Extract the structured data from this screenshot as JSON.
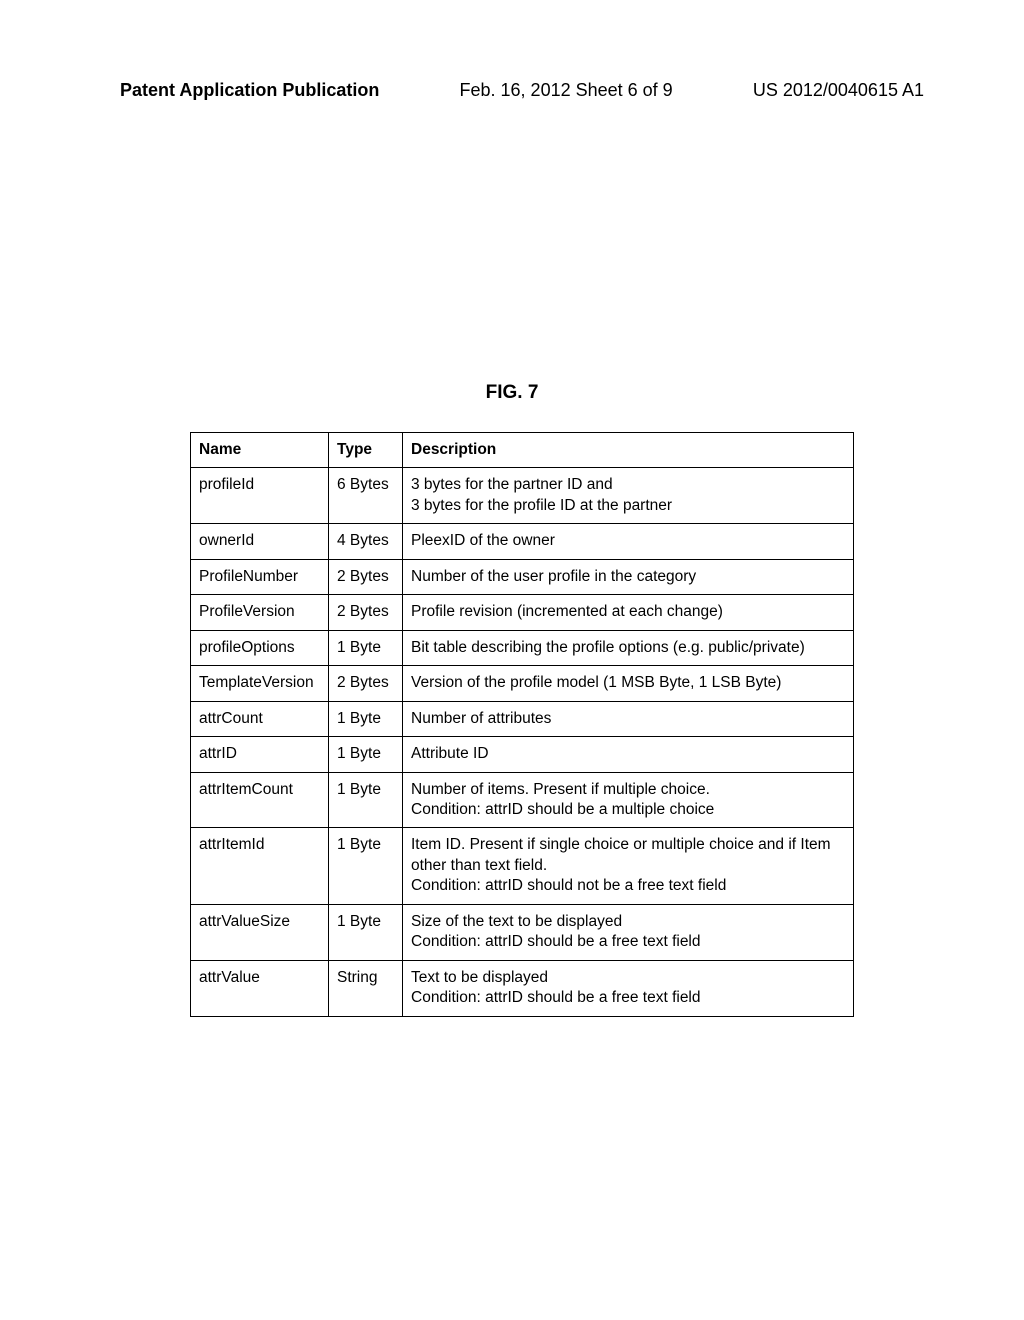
{
  "header": {
    "left": "Patent Application Publication",
    "center": "Feb. 16, 2012  Sheet 6 of 9",
    "right": "US 2012/0040615 A1"
  },
  "figure_label": "FIG. 7",
  "table": {
    "headers": [
      "Name",
      "Type",
      "Description"
    ],
    "rows": [
      {
        "name": "profileId",
        "type": "6 Bytes",
        "desc": "3 bytes for the partner ID and\n3 bytes for the profile ID at the partner"
      },
      {
        "name": "ownerId",
        "type": "4 Bytes",
        "desc": "PleexID of the owner"
      },
      {
        "name": "ProfileNumber",
        "type": "2 Bytes",
        "desc": "Number of the user profile in the category"
      },
      {
        "name": "ProfileVersion",
        "type": "2 Bytes",
        "desc": "Profile revision (incremented at each change)"
      },
      {
        "name": "profileOptions",
        "type": "1 Byte",
        "desc": "Bit table describing the profile options (e.g. public/private)"
      },
      {
        "name": "TemplateVersion",
        "type": "2 Bytes",
        "desc": "Version of the profile model (1 MSB Byte, 1 LSB Byte)"
      },
      {
        "name": "attrCount",
        "type": "1 Byte",
        "desc": "Number of attributes"
      },
      {
        "name": "attrID",
        "type": "1 Byte",
        "desc": "Attribute ID"
      },
      {
        "name": "attrItemCount",
        "type": "1 Byte",
        "desc": "Number of items. Present if multiple choice.\nCondition: attrID should be a multiple choice"
      },
      {
        "name": "attrItemId",
        "type": "1 Byte",
        "desc": "Item ID. Present if single choice or multiple choice and if Item other than text field.\nCondition: attrID should not be a free text field"
      },
      {
        "name": "attrValueSize",
        "type": "1 Byte",
        "desc": "Size of the text to be displayed\nCondition: attrID should be a free text field"
      },
      {
        "name": "attrValue",
        "type": "String",
        "desc": "Text to be displayed\nCondition: attrID should be a free text field"
      }
    ]
  }
}
